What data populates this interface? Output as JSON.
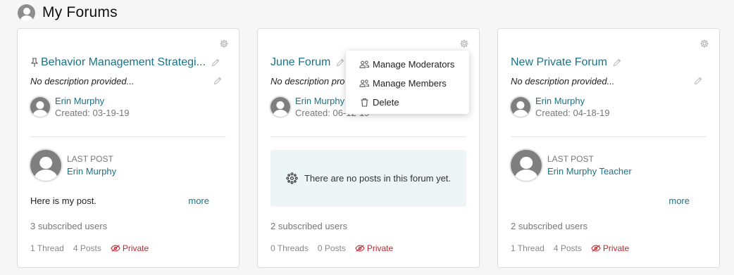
{
  "header": {
    "title": "My Forums"
  },
  "forums": [
    {
      "title": "Behavior Management Strategi...",
      "description": "No description provided...",
      "creator_name": "Erin Murphy",
      "created": "Created: 03-19-19",
      "last_post_label": "LAST POST",
      "last_post_author": "Erin Murphy",
      "post_text": "Here is my post.",
      "more": "more",
      "subscribed": "3 subscribed users",
      "threads": "1 Thread",
      "posts": "4 Posts",
      "privacy": "Private"
    },
    {
      "title": "June Forum",
      "description": "No description pro",
      "creator_name": "Erin Murphy",
      "created": "Created: 06-12-19",
      "no_posts_text": "There are no posts in this forum yet.",
      "subscribed": "2 subscribed users",
      "threads": "0 Threads",
      "posts": "0 Posts",
      "privacy": "Private"
    },
    {
      "title": "New Private Forum",
      "description": "No description provided...",
      "creator_name": "Erin Murphy",
      "created": "Created: 04-18-19",
      "last_post_label": "LAST POST",
      "last_post_author": "Erin Murphy Teacher",
      "more": "more",
      "subscribed": "2 subscribed users",
      "threads": "1 Thread",
      "posts": "4 Posts",
      "privacy": "Private"
    }
  ],
  "menu": {
    "items": [
      {
        "label": "Manage Moderators",
        "icon": "users-icon"
      },
      {
        "label": "Manage Members",
        "icon": "users-icon"
      },
      {
        "label": "Delete",
        "icon": "trash-icon"
      }
    ]
  },
  "colors": {
    "link": "#1a7388",
    "private": "#c0272d",
    "empty_bg": "#eef5f6"
  }
}
